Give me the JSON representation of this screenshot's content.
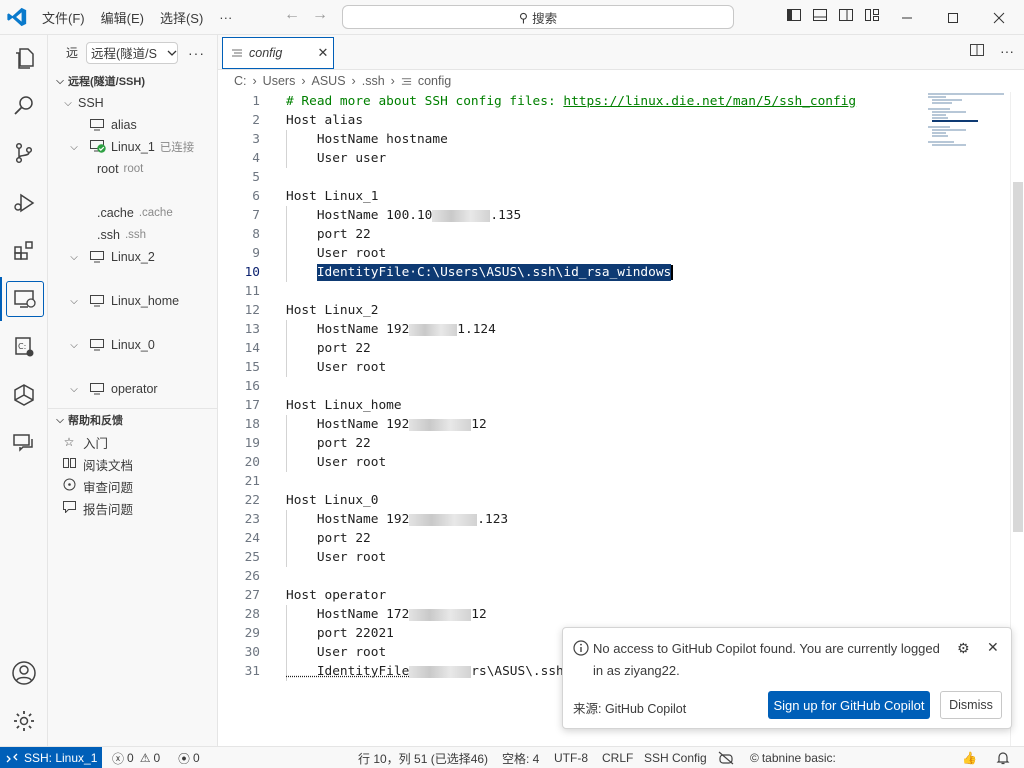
{
  "titlebar": {
    "menu": [
      "文件(F)",
      "编辑(E)",
      "选择(S)",
      "···"
    ],
    "search_text": "搜索"
  },
  "sidebar": {
    "header_label": "远",
    "remote_select_value": "远程(隧道/S",
    "section_title": "远程(隧道/SSH)",
    "ssh_group": "SSH",
    "hosts": [
      {
        "name": "alias"
      },
      {
        "name": "Linux_1",
        "status": "已连接"
      },
      {
        "name": "Linux_2"
      },
      {
        "name": "Linux_home"
      },
      {
        "name": "Linux_0"
      },
      {
        "name": "operator"
      }
    ],
    "linux1_children": [
      {
        "name": "root",
        "desc": "root"
      },
      {
        "name": ".cache",
        "desc": ".cache"
      },
      {
        "name": ".ssh",
        "desc": ".ssh"
      }
    ],
    "help": {
      "title": "帮助和反馈",
      "items": [
        "入门",
        "阅读文档",
        "审查问题",
        "报告问题"
      ]
    }
  },
  "editor": {
    "tab_name": "config",
    "breadcrumb": [
      "C:",
      "Users",
      "ASUS",
      ".ssh",
      "config"
    ],
    "lines": [
      {
        "n": "1",
        "t": "# Read more about SSH config files: "
      },
      {
        "n": "2",
        "t": "Host alias"
      },
      {
        "n": "3",
        "t": "    HostName hostname"
      },
      {
        "n": "4",
        "t": "    User user"
      },
      {
        "n": "5",
        "t": ""
      },
      {
        "n": "6",
        "t": "Host Linux_1"
      },
      {
        "n": "7",
        "a": "    HostName 100.10",
        "b": ".135"
      },
      {
        "n": "8",
        "t": "    port 22"
      },
      {
        "n": "9",
        "t": "    User root"
      },
      {
        "n": "10",
        "t": "IdentityFile·C:\\Users\\ASUS\\.ssh\\id_rsa_windows"
      },
      {
        "n": "11",
        "t": ""
      },
      {
        "n": "12",
        "t": "Host Linux_2"
      },
      {
        "n": "13",
        "a": "    HostName 192",
        "b": "1.124"
      },
      {
        "n": "14",
        "t": "    port 22"
      },
      {
        "n": "15",
        "t": "    User root"
      },
      {
        "n": "16",
        "t": ""
      },
      {
        "n": "17",
        "t": "Host Linux_home"
      },
      {
        "n": "18",
        "a": "    HostName 192",
        "b": "12"
      },
      {
        "n": "19",
        "t": "    port 22"
      },
      {
        "n": "20",
        "t": "    User root"
      },
      {
        "n": "21",
        "t": ""
      },
      {
        "n": "22",
        "t": "Host Linux_0"
      },
      {
        "n": "23",
        "a": "    HostName 192",
        "b": ".123"
      },
      {
        "n": "24",
        "t": "    port 22"
      },
      {
        "n": "25",
        "t": "    User root"
      },
      {
        "n": "26",
        "t": ""
      },
      {
        "n": "27",
        "t": "Host operator"
      },
      {
        "n": "28",
        "a": "    HostName 172",
        "b": "12"
      },
      {
        "n": "29",
        "t": "    port 22021"
      },
      {
        "n": "30",
        "t": "    User root"
      },
      {
        "n": "31",
        "a": "    IdentityFile",
        "b": "rs\\ASUS\\.ssh\\"
      }
    ],
    "comment_url": "https://linux.die.net/man/5/ssh_config"
  },
  "notification": {
    "message": "No access to GitHub Copilot found. You are currently logged in as ziyang22.",
    "source": "来源: GitHub Copilot",
    "primary_button": "Sign up for GitHub Copilot",
    "secondary_button": "Dismiss"
  },
  "statusbar": {
    "remote": "SSH: Linux_1",
    "errors": "0",
    "warnings": "0",
    "ports": "0",
    "cursor_pos": "行 10，列 51 (已选择46)",
    "spaces": "空格: 4",
    "encoding": "UTF-8",
    "eol": "CRLF",
    "language": "SSH Config",
    "tabnine": "tabnine basic:"
  },
  "colors": {
    "accent": "#005fb8",
    "selection": "#0e3a73",
    "comment": "#008000",
    "connected": "#2ea043"
  }
}
